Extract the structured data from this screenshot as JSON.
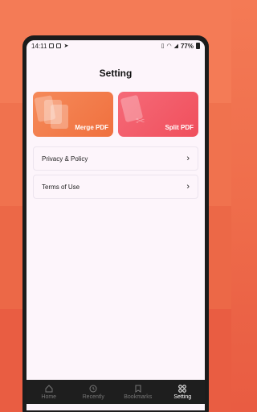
{
  "status_bar": {
    "time": "14:11",
    "battery": "77%"
  },
  "page": {
    "title": "Setting"
  },
  "cards": [
    {
      "label": "Merge PDF",
      "color": "#f0703e"
    },
    {
      "label": "Split PDF",
      "color": "#f04f5c"
    }
  ],
  "menu": [
    {
      "label": "Privacy & Policy"
    },
    {
      "label": "Terms of Use"
    }
  ],
  "tabs": [
    {
      "label": "Home",
      "icon": "home-icon",
      "active": false
    },
    {
      "label": "Recently",
      "icon": "clock-icon",
      "active": false
    },
    {
      "label": "Bookmarks",
      "icon": "bookmark-icon",
      "active": false
    },
    {
      "label": "Setting",
      "icon": "grid-icon",
      "active": true
    }
  ]
}
